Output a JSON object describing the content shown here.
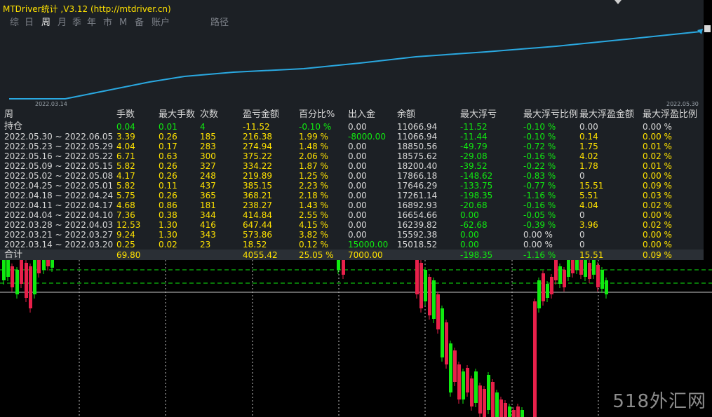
{
  "title": "MTDriver统计 ,V3.12 (http://mtdriver.cn)",
  "tabs": [
    {
      "label": "综",
      "active": false
    },
    {
      "label": "日",
      "active": false
    },
    {
      "label": "周",
      "active": true
    },
    {
      "label": "月",
      "active": false
    },
    {
      "label": "季",
      "active": false
    },
    {
      "label": "年",
      "active": false
    },
    {
      "label": "市",
      "active": false
    },
    {
      "label": "M",
      "active": false
    },
    {
      "label": "备",
      "active": false
    },
    {
      "label": "账户",
      "active": false
    },
    {
      "label": "路径",
      "active": false
    }
  ],
  "equity": {
    "start_date": "2022.03.14",
    "end_date": "2022.05.30",
    "line_color": "#2aa8e0"
  },
  "table": {
    "headers": [
      "周",
      "手数",
      "最大手数",
      "次数",
      "盈亏金额",
      "百分比%",
      "出入金",
      "余额",
      "最大浮亏",
      "最大浮亏比例",
      "最大浮盈金额",
      "最大浮盈比例"
    ],
    "holding": [
      "持仓",
      "0.04",
      "0.01",
      "4",
      "-11.52",
      "-0.10 %",
      "0.00",
      "11066.94",
      "-11.52",
      "-0.10 %",
      "0.00",
      "0.00 %"
    ],
    "rows": [
      [
        "2022.05.30 ~ 2022.06.05",
        "3.39",
        "0.26",
        "185",
        "216.38",
        "1.99 %",
        "-8000.00",
        "11066.94",
        "-11.44",
        "-0.10 %",
        "0.14",
        "0.00 %"
      ],
      [
        "2022.05.23 ~ 2022.05.29",
        "4.04",
        "0.17",
        "283",
        "274.94",
        "1.48 %",
        "0.00",
        "18850.56",
        "-49.79",
        "-0.72 %",
        "1.75",
        "0.01 %"
      ],
      [
        "2022.05.16 ~ 2022.05.22",
        "6.71",
        "0.63",
        "300",
        "375.22",
        "2.06 %",
        "0.00",
        "18575.62",
        "-29.08",
        "-0.16 %",
        "4.02",
        "0.02 %"
      ],
      [
        "2022.05.09 ~ 2022.05.15",
        "5.82",
        "0.26",
        "327",
        "334.22",
        "1.87 %",
        "0.00",
        "18200.40",
        "-39.52",
        "-0.22 %",
        "1.78",
        "0.01 %"
      ],
      [
        "2022.05.02 ~ 2022.05.08",
        "4.17",
        "0.26",
        "248",
        "219.89",
        "1.25 %",
        "0.00",
        "17866.18",
        "-148.62",
        "-0.83 %",
        "0",
        "0.00 %"
      ],
      [
        "2022.04.25 ~ 2022.05.01",
        "5.82",
        "0.11",
        "437",
        "385.15",
        "2.23 %",
        "0.00",
        "17646.29",
        "-133.75",
        "-0.77 %",
        "15.51",
        "0.09 %"
      ],
      [
        "2022.04.18 ~ 2022.04.24",
        "5.75",
        "0.26",
        "365",
        "368.21",
        "2.18 %",
        "0.00",
        "17261.14",
        "-198.35",
        "-1.16 %",
        "5.51",
        "0.03 %"
      ],
      [
        "2022.04.11 ~ 2022.04.17",
        "4.68",
        "0.86",
        "181",
        "238.27",
        "1.43 %",
        "0.00",
        "16892.93",
        "-20.68",
        "-0.16 %",
        "4.04",
        "0.02 %"
      ],
      [
        "2022.04.04 ~ 2022.04.10",
        "7.36",
        "0.38",
        "344",
        "414.84",
        "2.55 %",
        "0.00",
        "16654.66",
        "0.00",
        "-0.05 %",
        "0",
        "0.00 %"
      ],
      [
        "2022.03.28 ~ 2022.04.03",
        "12.53",
        "1.30",
        "416",
        "647.44",
        "4.15 %",
        "0.00",
        "16239.82",
        "-62.68",
        "-0.39 %",
        "3.96",
        "0.02 %"
      ],
      [
        "2022.03.21 ~ 2022.03.27",
        "9.24",
        "1.30",
        "343",
        "573.86",
        "3.82 %",
        "0.00",
        "15592.38",
        "0.00",
        "0.00 %",
        "0",
        "0.00 %"
      ],
      [
        "2022.03.14 ~ 2022.03.20",
        "0.25",
        "0.02",
        "23",
        "18.52",
        "0.12 %",
        "15000.00",
        "15018.52",
        "0.00",
        "0.00 %",
        "0",
        "0.00 %"
      ]
    ],
    "total": [
      "合计",
      "69.80",
      "",
      "",
      "4055.42",
      "25.05 %",
      "7000.00",
      "",
      "-198.35",
      "-1.16 %",
      "15.51",
      "0.09 %"
    ]
  },
  "colors": {
    "panel_bg": "#1c2025",
    "text_white": "#d8d8d8",
    "text_yellow": "#ffe200",
    "text_green": "#10ea10",
    "bull_candle": "#10ea10",
    "bear_candle": "#e8204a"
  },
  "watermark": "518外汇网"
}
